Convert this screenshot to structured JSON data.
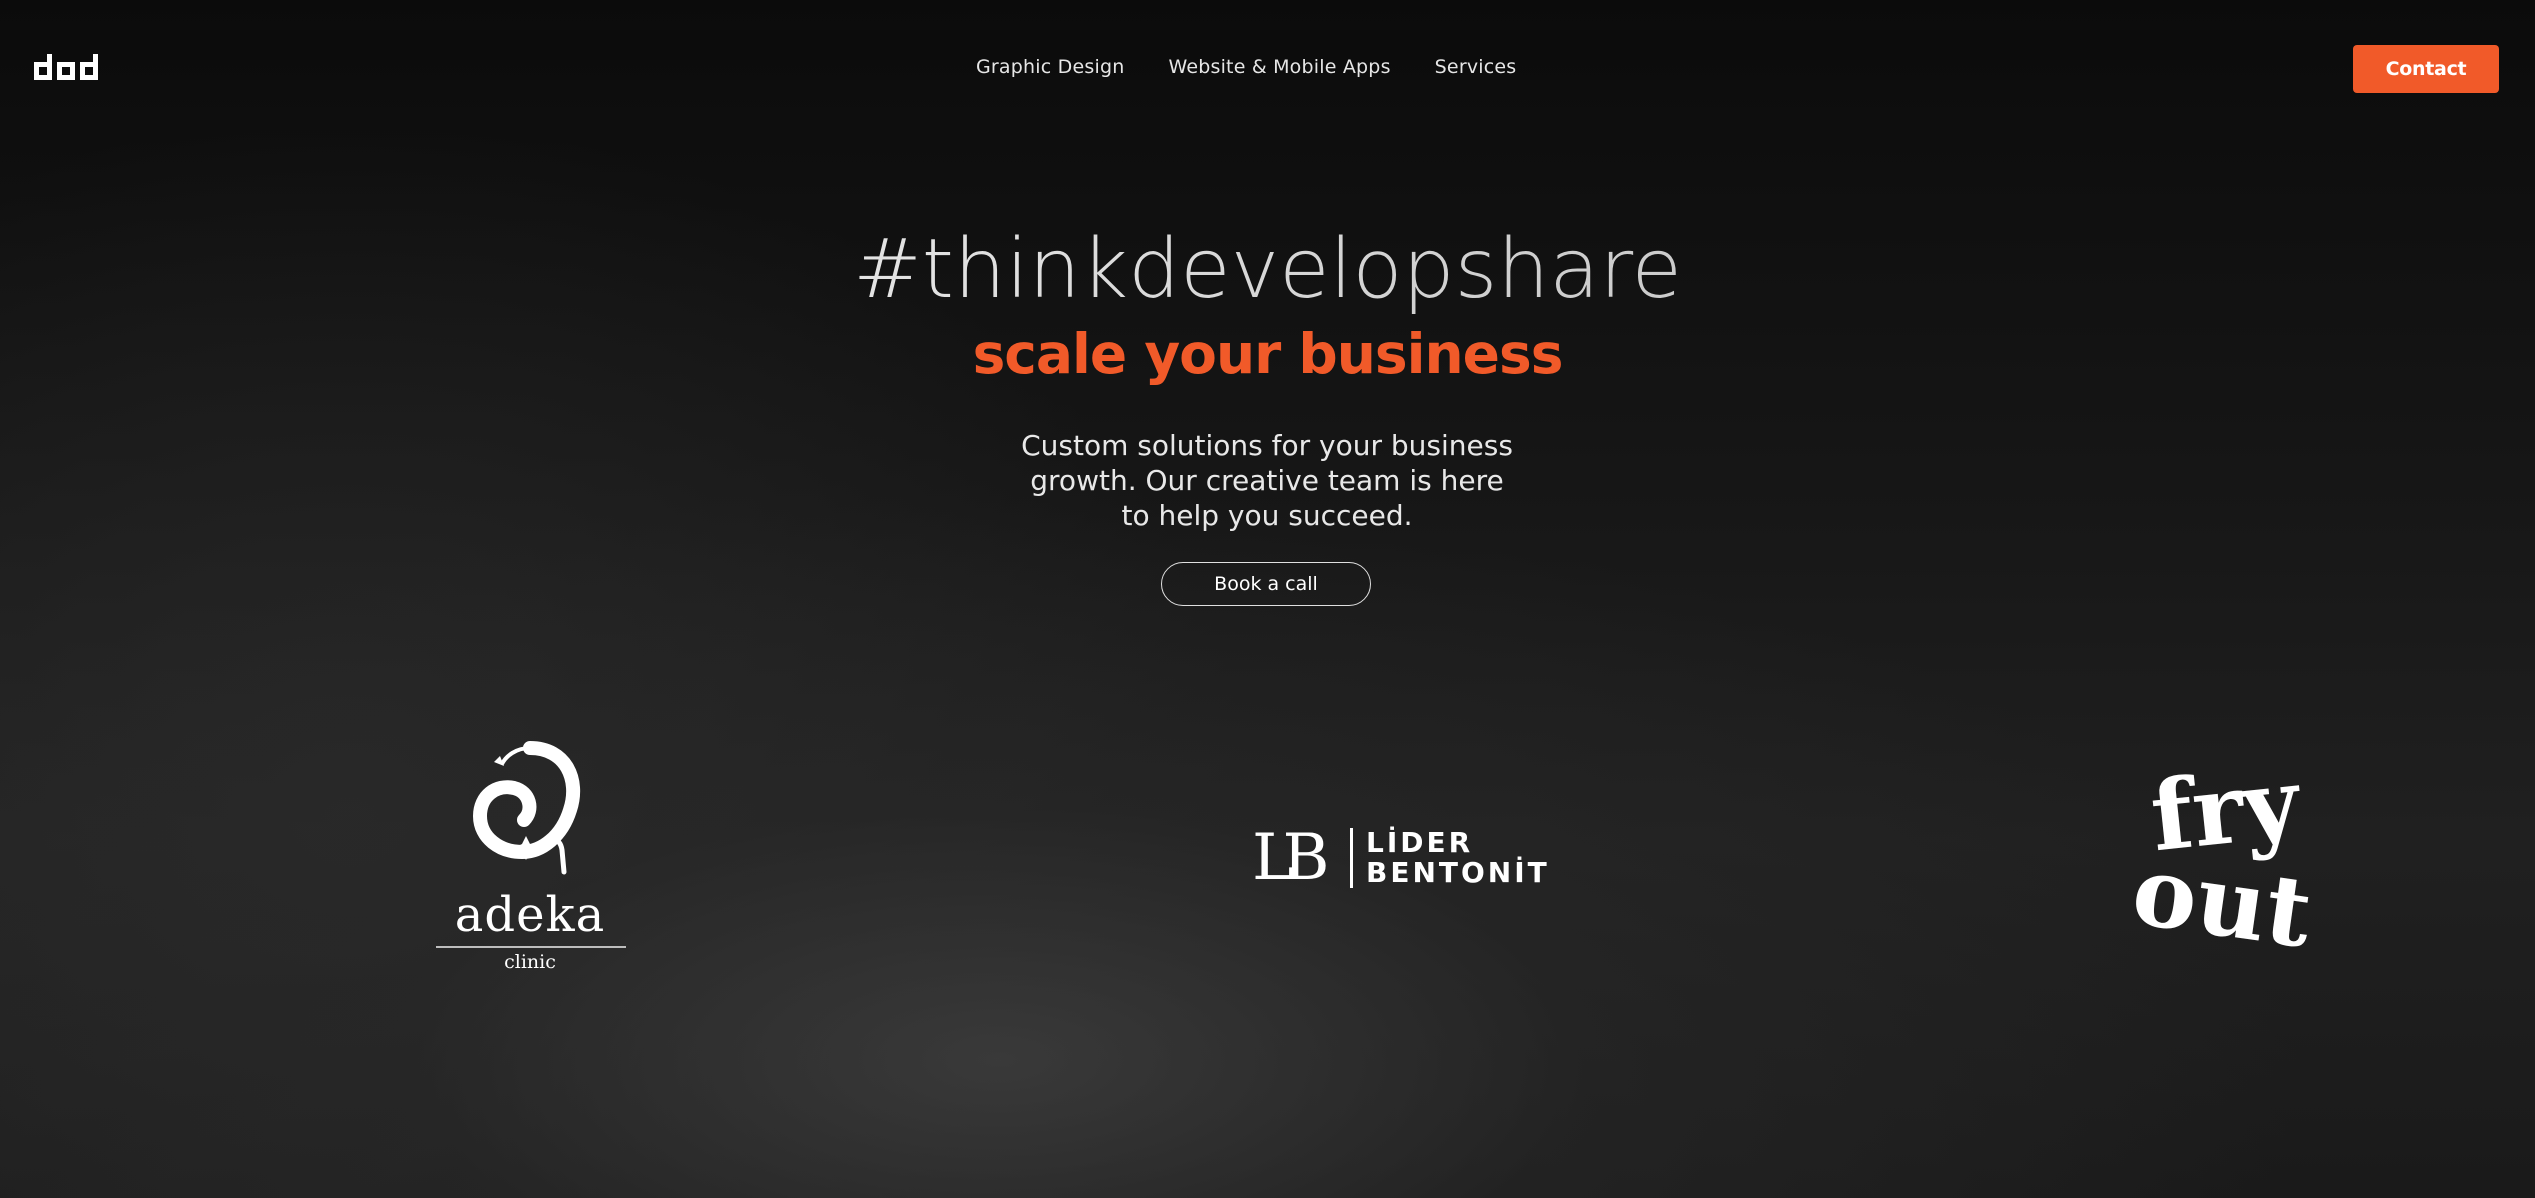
{
  "header": {
    "logo_icon": "dod-logo-icon",
    "nav": [
      {
        "label": "Graphic Design"
      },
      {
        "label": "Website & Mobile Apps"
      },
      {
        "label": "Services"
      }
    ],
    "contact_label": "Contact"
  },
  "hero": {
    "title": "#thinkdevelopshare",
    "subtitle": "scale your business",
    "description": "Custom solutions for your business growth. Our creative team is here to help you succeed.",
    "cta_label": "Book a call"
  },
  "clients": [
    {
      "name": "adeka",
      "tagline": "clinic"
    },
    {
      "mark": "LB",
      "line1": "LİDER",
      "line2": "BENTONİT"
    },
    {
      "word1": "fry",
      "word2": "out"
    }
  ],
  "colors": {
    "accent": "#f15a29",
    "background": "#0d0d0d",
    "text": "#ffffff"
  }
}
